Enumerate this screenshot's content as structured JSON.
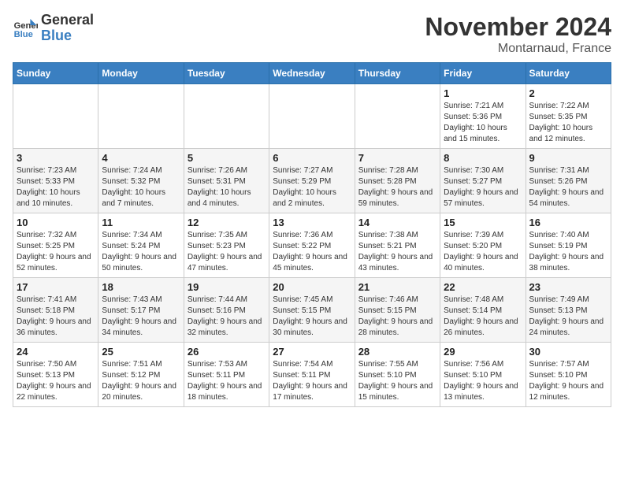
{
  "header": {
    "logo_line1": "General",
    "logo_line2": "Blue",
    "month": "November 2024",
    "location": "Montarnaud, France"
  },
  "weekdays": [
    "Sunday",
    "Monday",
    "Tuesday",
    "Wednesday",
    "Thursday",
    "Friday",
    "Saturday"
  ],
  "weeks": [
    [
      {
        "day": "",
        "info": ""
      },
      {
        "day": "",
        "info": ""
      },
      {
        "day": "",
        "info": ""
      },
      {
        "day": "",
        "info": ""
      },
      {
        "day": "",
        "info": ""
      },
      {
        "day": "1",
        "info": "Sunrise: 7:21 AM\nSunset: 5:36 PM\nDaylight: 10 hours and 15 minutes."
      },
      {
        "day": "2",
        "info": "Sunrise: 7:22 AM\nSunset: 5:35 PM\nDaylight: 10 hours and 12 minutes."
      }
    ],
    [
      {
        "day": "3",
        "info": "Sunrise: 7:23 AM\nSunset: 5:33 PM\nDaylight: 10 hours and 10 minutes."
      },
      {
        "day": "4",
        "info": "Sunrise: 7:24 AM\nSunset: 5:32 PM\nDaylight: 10 hours and 7 minutes."
      },
      {
        "day": "5",
        "info": "Sunrise: 7:26 AM\nSunset: 5:31 PM\nDaylight: 10 hours and 4 minutes."
      },
      {
        "day": "6",
        "info": "Sunrise: 7:27 AM\nSunset: 5:29 PM\nDaylight: 10 hours and 2 minutes."
      },
      {
        "day": "7",
        "info": "Sunrise: 7:28 AM\nSunset: 5:28 PM\nDaylight: 9 hours and 59 minutes."
      },
      {
        "day": "8",
        "info": "Sunrise: 7:30 AM\nSunset: 5:27 PM\nDaylight: 9 hours and 57 minutes."
      },
      {
        "day": "9",
        "info": "Sunrise: 7:31 AM\nSunset: 5:26 PM\nDaylight: 9 hours and 54 minutes."
      }
    ],
    [
      {
        "day": "10",
        "info": "Sunrise: 7:32 AM\nSunset: 5:25 PM\nDaylight: 9 hours and 52 minutes."
      },
      {
        "day": "11",
        "info": "Sunrise: 7:34 AM\nSunset: 5:24 PM\nDaylight: 9 hours and 50 minutes."
      },
      {
        "day": "12",
        "info": "Sunrise: 7:35 AM\nSunset: 5:23 PM\nDaylight: 9 hours and 47 minutes."
      },
      {
        "day": "13",
        "info": "Sunrise: 7:36 AM\nSunset: 5:22 PM\nDaylight: 9 hours and 45 minutes."
      },
      {
        "day": "14",
        "info": "Sunrise: 7:38 AM\nSunset: 5:21 PM\nDaylight: 9 hours and 43 minutes."
      },
      {
        "day": "15",
        "info": "Sunrise: 7:39 AM\nSunset: 5:20 PM\nDaylight: 9 hours and 40 minutes."
      },
      {
        "day": "16",
        "info": "Sunrise: 7:40 AM\nSunset: 5:19 PM\nDaylight: 9 hours and 38 minutes."
      }
    ],
    [
      {
        "day": "17",
        "info": "Sunrise: 7:41 AM\nSunset: 5:18 PM\nDaylight: 9 hours and 36 minutes."
      },
      {
        "day": "18",
        "info": "Sunrise: 7:43 AM\nSunset: 5:17 PM\nDaylight: 9 hours and 34 minutes."
      },
      {
        "day": "19",
        "info": "Sunrise: 7:44 AM\nSunset: 5:16 PM\nDaylight: 9 hours and 32 minutes."
      },
      {
        "day": "20",
        "info": "Sunrise: 7:45 AM\nSunset: 5:15 PM\nDaylight: 9 hours and 30 minutes."
      },
      {
        "day": "21",
        "info": "Sunrise: 7:46 AM\nSunset: 5:15 PM\nDaylight: 9 hours and 28 minutes."
      },
      {
        "day": "22",
        "info": "Sunrise: 7:48 AM\nSunset: 5:14 PM\nDaylight: 9 hours and 26 minutes."
      },
      {
        "day": "23",
        "info": "Sunrise: 7:49 AM\nSunset: 5:13 PM\nDaylight: 9 hours and 24 minutes."
      }
    ],
    [
      {
        "day": "24",
        "info": "Sunrise: 7:50 AM\nSunset: 5:13 PM\nDaylight: 9 hours and 22 minutes."
      },
      {
        "day": "25",
        "info": "Sunrise: 7:51 AM\nSunset: 5:12 PM\nDaylight: 9 hours and 20 minutes."
      },
      {
        "day": "26",
        "info": "Sunrise: 7:53 AM\nSunset: 5:11 PM\nDaylight: 9 hours and 18 minutes."
      },
      {
        "day": "27",
        "info": "Sunrise: 7:54 AM\nSunset: 5:11 PM\nDaylight: 9 hours and 17 minutes."
      },
      {
        "day": "28",
        "info": "Sunrise: 7:55 AM\nSunset: 5:10 PM\nDaylight: 9 hours and 15 minutes."
      },
      {
        "day": "29",
        "info": "Sunrise: 7:56 AM\nSunset: 5:10 PM\nDaylight: 9 hours and 13 minutes."
      },
      {
        "day": "30",
        "info": "Sunrise: 7:57 AM\nSunset: 5:10 PM\nDaylight: 9 hours and 12 minutes."
      }
    ]
  ]
}
